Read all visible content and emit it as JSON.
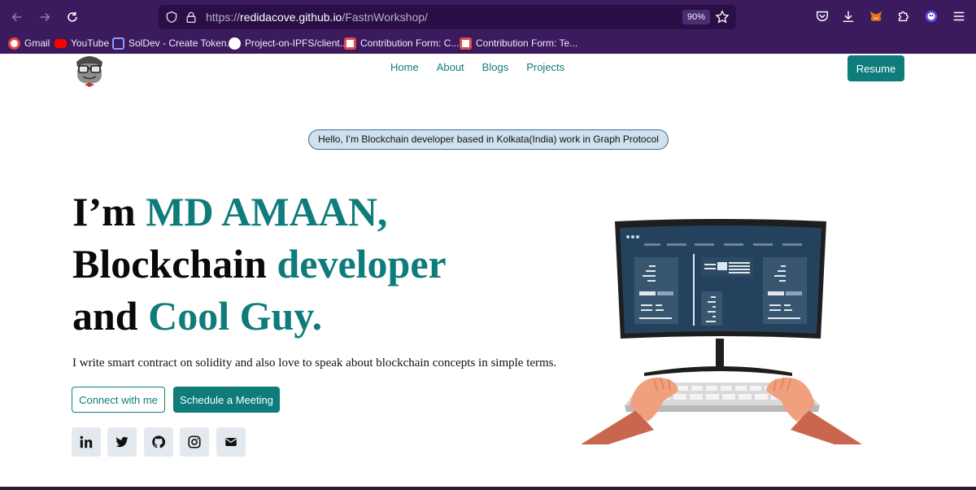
{
  "browser": {
    "url_prefix": "https://",
    "url_host": "redidacove.github.io",
    "url_path": "/FastnWorkshop/",
    "zoom": "90%",
    "bookmarks": [
      {
        "label": "Gmail",
        "icon": "gmail-icon",
        "color": "#ea4335"
      },
      {
        "label": "YouTube",
        "icon": "youtube-icon",
        "color": "#ff0000"
      },
      {
        "label": "SolDev - Create Token...",
        "icon": "soldev-icon",
        "color": "#8b9cff"
      },
      {
        "label": "Project-on-IPFS/client...",
        "icon": "github-icon",
        "color": "#ffffff"
      },
      {
        "label": "Contribution Form: C...",
        "icon": "form-icon",
        "color": "#e04b4b"
      },
      {
        "label": "Contribution Form: Te...",
        "icon": "form-icon",
        "color": "#e04b4b"
      }
    ]
  },
  "nav": {
    "items": [
      "Home",
      "About",
      "Blogs",
      "Projects"
    ],
    "resume_label": "Resume"
  },
  "hero": {
    "pill": "Hello, I’m Blockchain developer based in Kolkata(India) work in Graph Protocol",
    "line1_plain": "I’m ",
    "line1_accent": "MD AMAAN,",
    "line2_plain": "Blockchain ",
    "line2_accent": "developer",
    "line3_plain": "and ",
    "line3_accent": "Cool Guy.",
    "subtext": "I write smart contract on solidity and also love to speak about blockchain concepts in simple terms.",
    "connect_label": "Connect with me",
    "schedule_label": "Schedule a Meeting"
  },
  "social": [
    "linkedin-icon",
    "twitter-icon",
    "github-icon",
    "instagram-icon",
    "mail-icon"
  ],
  "colors": {
    "accent": "#0e7c7b",
    "chrome": "#3b1a5e",
    "urlbar": "#2a0f47"
  }
}
